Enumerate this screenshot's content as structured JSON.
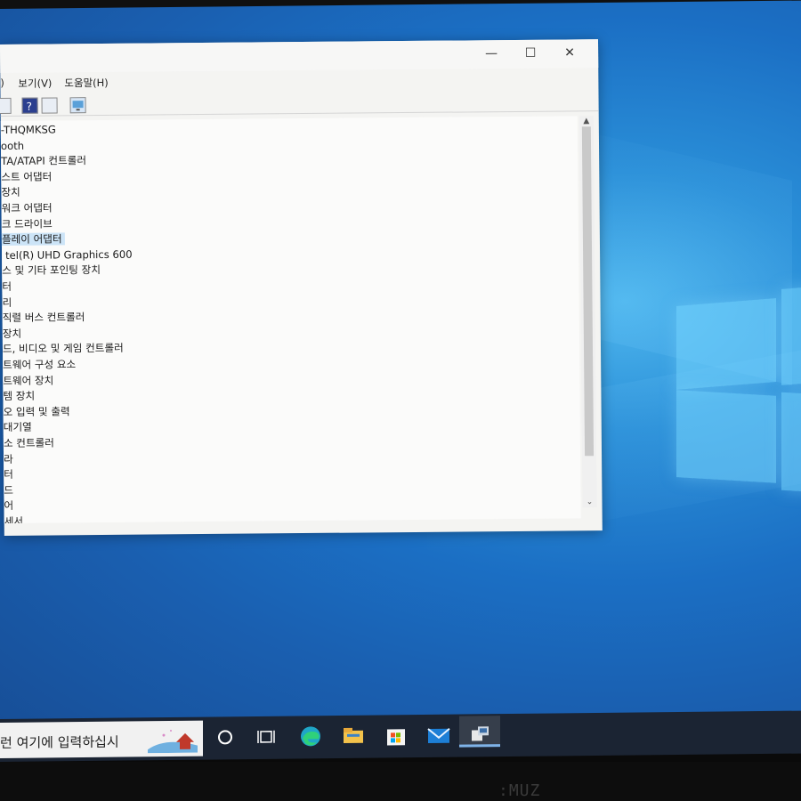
{
  "window": {
    "controls": {
      "minimize": "—",
      "maximize": "☐",
      "close": "✕"
    },
    "menus": [
      ")",
      "보기(V)",
      "도움말(H)"
    ]
  },
  "tree_items": [
    {
      "label": "-THQMKSG",
      "indent": 0,
      "selected": false
    },
    {
      "label": "ooth",
      "indent": 0,
      "selected": false
    },
    {
      "label": "TA/ATAPI 컨트롤러",
      "indent": 0,
      "selected": false
    },
    {
      "label": "스트 어댑터",
      "indent": 0,
      "selected": false
    },
    {
      "label": "장치",
      "indent": 0,
      "selected": false
    },
    {
      "label": "워크 어댑터",
      "indent": 0,
      "selected": false
    },
    {
      "label": "크 드라이브",
      "indent": 0,
      "selected": false
    },
    {
      "label": "플레이 어댑터",
      "indent": 0,
      "selected": true
    },
    {
      "label": "tel(R) UHD Graphics 600",
      "indent": 1,
      "selected": false
    },
    {
      "label": "스 및 기타 포인팅 장치",
      "indent": 0,
      "selected": false
    },
    {
      "label": "터",
      "indent": 0,
      "selected": false
    },
    {
      "label": "리",
      "indent": 0,
      "selected": false
    },
    {
      "label": "직렬 버스 컨트롤러",
      "indent": 0,
      "selected": false
    },
    {
      "label": "장치",
      "indent": 0,
      "selected": false
    },
    {
      "label": "드, 비디오 및 게임 컨트롤러",
      "indent": 0,
      "selected": false
    },
    {
      "label": "트웨어 구성 요소",
      "indent": 0,
      "selected": false
    },
    {
      "label": "트웨어 장치",
      "indent": 0,
      "selected": false
    },
    {
      "label": "템 장치",
      "indent": 0,
      "selected": false
    },
    {
      "label": "오 입력 및 출력",
      "indent": 0,
      "selected": false
    },
    {
      "label": "대기열",
      "indent": 0,
      "selected": false
    },
    {
      "label": "소 컨트롤러",
      "indent": 0,
      "selected": false
    },
    {
      "label": "라",
      "indent": 0,
      "selected": false
    },
    {
      "label": "터",
      "indent": 0,
      "selected": false
    },
    {
      "label": "드",
      "indent": 0,
      "selected": false
    },
    {
      "label": "어",
      "indent": 0,
      "selected": false
    },
    {
      "label": "세서",
      "indent": 0,
      "selected": false
    }
  ],
  "taskbar": {
    "search_text": "런 여기에 입력하십시",
    "icons": [
      "cortana-icon",
      "task-view-icon",
      "edge-icon",
      "file-explorer-icon",
      "store-icon",
      "mail-icon",
      "device-manager-icon"
    ]
  },
  "monitor_brand": ":MUZ",
  "colors": {
    "desktop": "#1b6fc4",
    "selection": "#cce4f7",
    "taskbar": "#1b2433"
  }
}
